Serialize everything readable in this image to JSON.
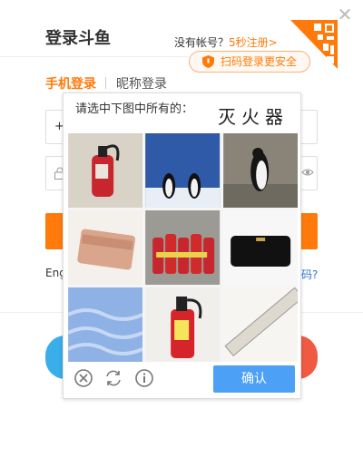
{
  "header": {
    "title": "登录斗鱼",
    "register_prefix": "没有帐号？",
    "register_link": "5秒注册>",
    "qr_tip": "扫码登录更安全"
  },
  "tabs": [
    {
      "label": "手机登录",
      "active": true
    },
    {
      "label": "昵称登录",
      "active": false
    }
  ],
  "form": {
    "phone_prefix": "+",
    "eng_text": "Eng",
    "forgot_text": "码?"
  },
  "captcha": {
    "prompt": "请选中下图中所有的：",
    "target": "灭火器",
    "confirm_label": "确认",
    "tiles": [
      {
        "subject": "fire-extinguisher"
      },
      {
        "subject": "penguins-snow"
      },
      {
        "subject": "penguin-rocks"
      },
      {
        "subject": "pink-wallet"
      },
      {
        "subject": "fire-extinguishers-group"
      },
      {
        "subject": "black-wallet"
      },
      {
        "subject": "blue-water"
      },
      {
        "subject": "fire-extinguisher-red"
      },
      {
        "subject": "ruler"
      }
    ],
    "icons": [
      "close-circle-icon",
      "refresh-icon",
      "info-icon"
    ]
  },
  "colors": {
    "accent": "#ff7a0a",
    "confirm": "#4ca0f5",
    "link": "#2a76d8"
  }
}
